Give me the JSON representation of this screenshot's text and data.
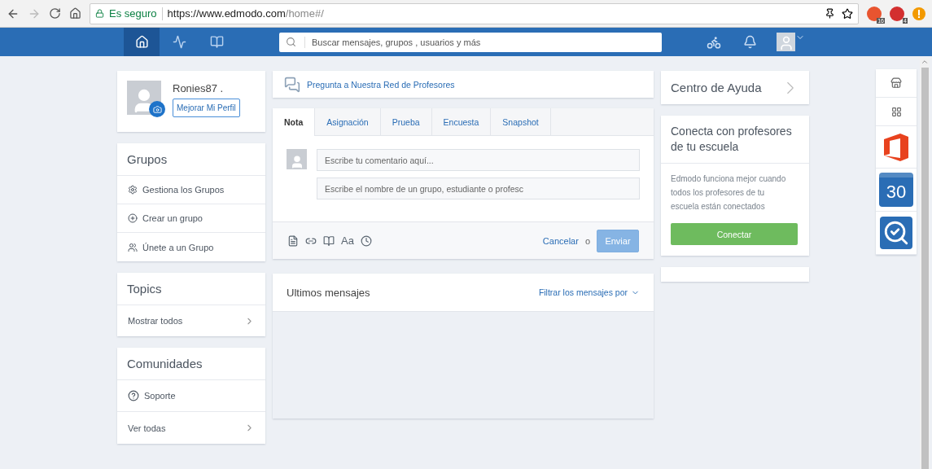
{
  "browser": {
    "security": "Es seguro",
    "url_host": "https://www.edmodo.com",
    "url_path": "/home#/",
    "extensions": [
      {
        "badge": "16",
        "color": "#e8542f"
      },
      {
        "badge": "4",
        "color": "#d32f2f"
      }
    ],
    "forward_disabled": true
  },
  "nav": {
    "items": [
      {
        "kind": "home",
        "selected": true
      },
      {
        "kind": "activity",
        "selected": false
      },
      {
        "kind": "library",
        "selected": false
      }
    ],
    "search": {
      "placeholder": "Buscar mensajes, grupos , usuarios y más"
    }
  },
  "profile": {
    "name": "Ronies87 .",
    "button": "Mejorar Mi Perfil"
  },
  "groups": {
    "title": "Grupos",
    "items": [
      {
        "kind": "settings",
        "label": "Gestiona los Grupos"
      },
      {
        "kind": "add",
        "label": "Crear un grupo"
      },
      {
        "kind": "join",
        "label": "Únete a un Grupo"
      }
    ]
  },
  "topics": {
    "title": "Topics",
    "items": [
      {
        "kind": "more",
        "label": "Mostrar todos"
      }
    ]
  },
  "communities": {
    "title": "Comunidades",
    "items": [
      {
        "kind": "help",
        "label": "Soporte"
      },
      {
        "kind": "more",
        "label": "Ver todas"
      }
    ]
  },
  "ask": {
    "label": "Pregunta a Nuestra Red de Profesores"
  },
  "composer": {
    "tabs": [
      {
        "label": "Nota",
        "selected": true
      },
      {
        "label": "Asignación",
        "selected": false
      },
      {
        "label": "Prueba",
        "selected": false
      },
      {
        "label": "Encuesta",
        "selected": false
      },
      {
        "label": "Snapshot",
        "selected": false
      }
    ],
    "comment": {
      "placeholder": "Escribe tu comentario aquí..."
    },
    "recipients": {
      "placeholder": "Escribe el nombre de un grupo, estudiante o profesc"
    },
    "format_label": "Aa",
    "cancel": "Cancelar",
    "or": "o",
    "send": {
      "label": "Enviar",
      "disabled": true
    }
  },
  "feed": {
    "title": "Ultimos mensajes",
    "filter": "Filtrar los mensajes por"
  },
  "help": {
    "title": "Centro de Ayuda"
  },
  "connect": {
    "title": "Conecta con profesores de tu escuela",
    "text": "Edmodo funciona mejor cuando todos los profesores de tu escuela están conectados",
    "button": "Conectar"
  },
  "apps": [
    {
      "kind": "store"
    },
    {
      "kind": "grid"
    },
    {
      "kind": "office"
    },
    {
      "kind": "calendar",
      "label": "30"
    },
    {
      "kind": "review"
    }
  ]
}
